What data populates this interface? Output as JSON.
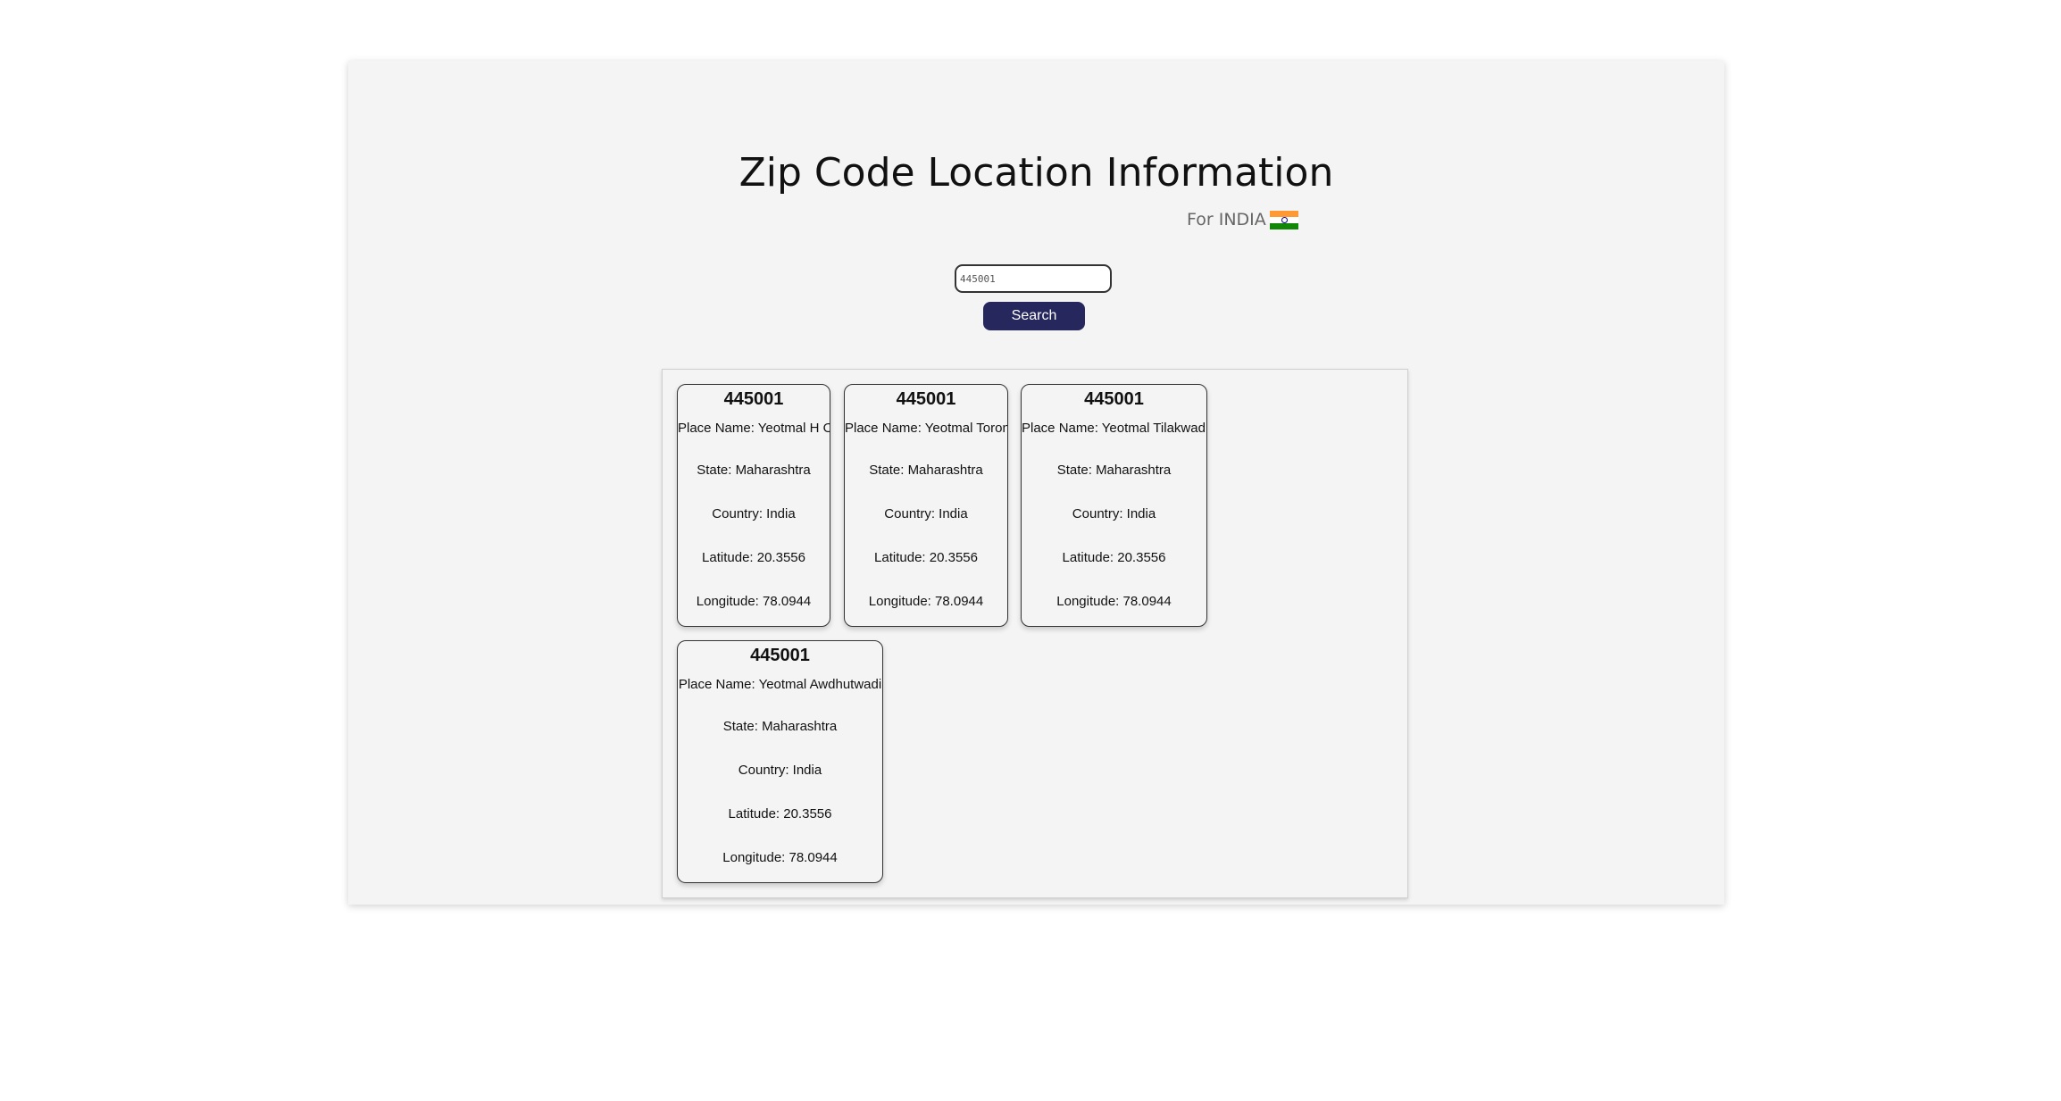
{
  "page": {
    "title": "Zip Code Location Information",
    "country_label": "For INDIA",
    "flag_icon": "india-flag-icon",
    "flag_colors": [
      "#ff9933",
      "#ffffff",
      "#138808"
    ]
  },
  "search": {
    "value": "445001",
    "button_label": "Search",
    "button_color": "#26275c"
  },
  "results": [
    {
      "zip": "445001",
      "place": "Place Name: Yeotmal H O",
      "state": "State: Maharashtra",
      "country": "Country: India",
      "latitude": "Latitude: 20.3556",
      "longitude": "Longitude: 78.0944"
    },
    {
      "zip": "445001",
      "place": "Place Name: Yeotmal Toron",
      "state": "State: Maharashtra",
      "country": "Country: India",
      "latitude": "Latitude: 20.3556",
      "longitude": "Longitude: 78.0944"
    },
    {
      "zip": "445001",
      "place": "Place Name: Yeotmal Tilakwadi",
      "state": "State: Maharashtra",
      "country": "Country: India",
      "latitude": "Latitude: 20.3556",
      "longitude": "Longitude: 78.0944"
    },
    {
      "zip": "445001",
      "place": "Place Name: Yeotmal Awdhutwadi",
      "state": "State: Maharashtra",
      "country": "Country: India",
      "latitude": "Latitude: 20.3556",
      "longitude": "Longitude: 78.0944"
    }
  ]
}
